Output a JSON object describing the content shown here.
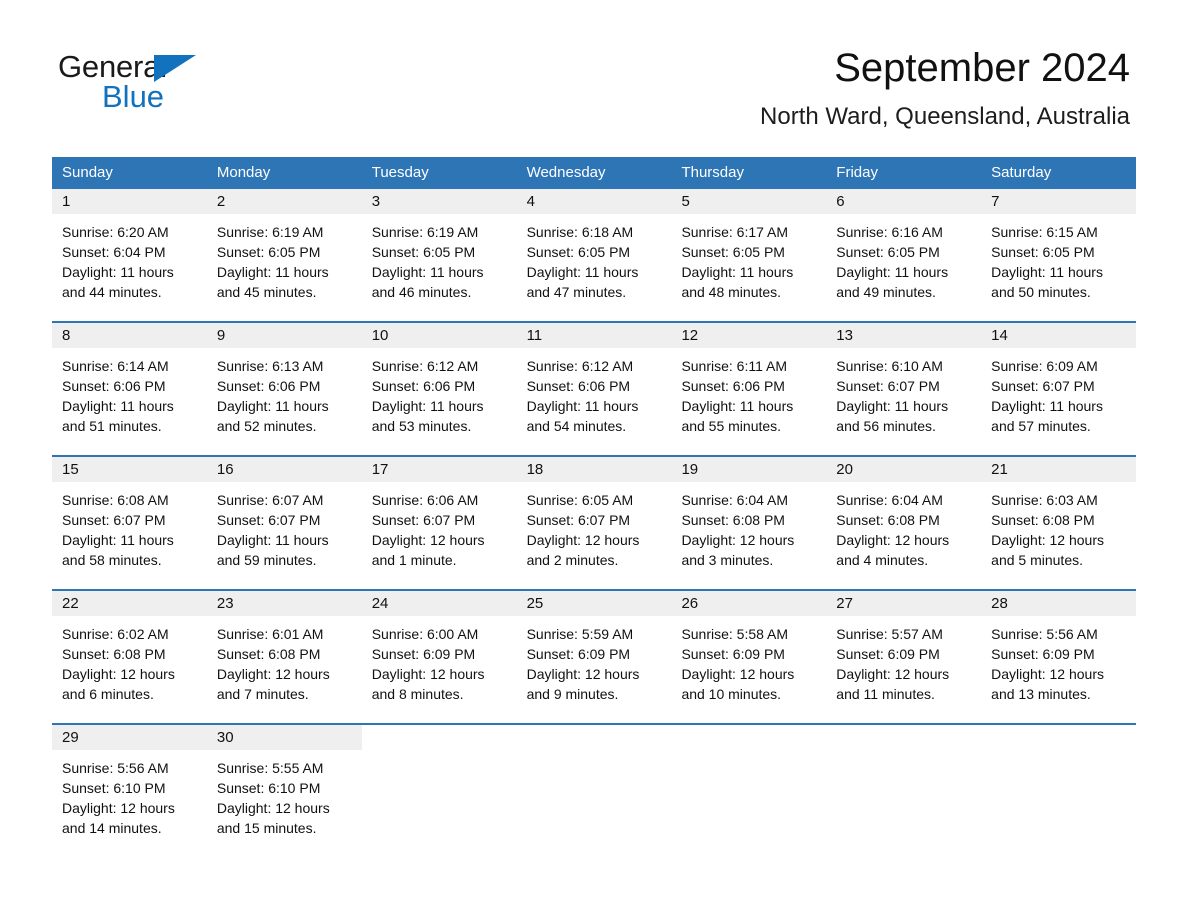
{
  "brand": {
    "line1": "General",
    "line2": "Blue",
    "accent_color": "#1272bd"
  },
  "header": {
    "month_title": "September 2024",
    "location": "North Ward, Queensland, Australia"
  },
  "calendar": {
    "header_color": "#2e75b6",
    "daynum_band_color": "#efefef",
    "weekday_headers": [
      "Sunday",
      "Monday",
      "Tuesday",
      "Wednesday",
      "Thursday",
      "Friday",
      "Saturday"
    ],
    "weeks": [
      [
        null,
        null,
        null,
        null,
        null,
        null,
        null
      ]
    ],
    "days": [
      {
        "day": "1",
        "sunrise": "Sunrise: 6:20 AM",
        "sunset": "Sunset: 6:04 PM",
        "daylight_line1": "Daylight: 11 hours",
        "daylight_line2": "and 44 minutes."
      },
      {
        "day": "2",
        "sunrise": "Sunrise: 6:19 AM",
        "sunset": "Sunset: 6:05 PM",
        "daylight_line1": "Daylight: 11 hours",
        "daylight_line2": "and 45 minutes."
      },
      {
        "day": "3",
        "sunrise": "Sunrise: 6:19 AM",
        "sunset": "Sunset: 6:05 PM",
        "daylight_line1": "Daylight: 11 hours",
        "daylight_line2": "and 46 minutes."
      },
      {
        "day": "4",
        "sunrise": "Sunrise: 6:18 AM",
        "sunset": "Sunset: 6:05 PM",
        "daylight_line1": "Daylight: 11 hours",
        "daylight_line2": "and 47 minutes."
      },
      {
        "day": "5",
        "sunrise": "Sunrise: 6:17 AM",
        "sunset": "Sunset: 6:05 PM",
        "daylight_line1": "Daylight: 11 hours",
        "daylight_line2": "and 48 minutes."
      },
      {
        "day": "6",
        "sunrise": "Sunrise: 6:16 AM",
        "sunset": "Sunset: 6:05 PM",
        "daylight_line1": "Daylight: 11 hours",
        "daylight_line2": "and 49 minutes."
      },
      {
        "day": "7",
        "sunrise": "Sunrise: 6:15 AM",
        "sunset": "Sunset: 6:05 PM",
        "daylight_line1": "Daylight: 11 hours",
        "daylight_line2": "and 50 minutes."
      },
      {
        "day": "8",
        "sunrise": "Sunrise: 6:14 AM",
        "sunset": "Sunset: 6:06 PM",
        "daylight_line1": "Daylight: 11 hours",
        "daylight_line2": "and 51 minutes."
      },
      {
        "day": "9",
        "sunrise": "Sunrise: 6:13 AM",
        "sunset": "Sunset: 6:06 PM",
        "daylight_line1": "Daylight: 11 hours",
        "daylight_line2": "and 52 minutes."
      },
      {
        "day": "10",
        "sunrise": "Sunrise: 6:12 AM",
        "sunset": "Sunset: 6:06 PM",
        "daylight_line1": "Daylight: 11 hours",
        "daylight_line2": "and 53 minutes."
      },
      {
        "day": "11",
        "sunrise": "Sunrise: 6:12 AM",
        "sunset": "Sunset: 6:06 PM",
        "daylight_line1": "Daylight: 11 hours",
        "daylight_line2": "and 54 minutes."
      },
      {
        "day": "12",
        "sunrise": "Sunrise: 6:11 AM",
        "sunset": "Sunset: 6:06 PM",
        "daylight_line1": "Daylight: 11 hours",
        "daylight_line2": "and 55 minutes."
      },
      {
        "day": "13",
        "sunrise": "Sunrise: 6:10 AM",
        "sunset": "Sunset: 6:07 PM",
        "daylight_line1": "Daylight: 11 hours",
        "daylight_line2": "and 56 minutes."
      },
      {
        "day": "14",
        "sunrise": "Sunrise: 6:09 AM",
        "sunset": "Sunset: 6:07 PM",
        "daylight_line1": "Daylight: 11 hours",
        "daylight_line2": "and 57 minutes."
      },
      {
        "day": "15",
        "sunrise": "Sunrise: 6:08 AM",
        "sunset": "Sunset: 6:07 PM",
        "daylight_line1": "Daylight: 11 hours",
        "daylight_line2": "and 58 minutes."
      },
      {
        "day": "16",
        "sunrise": "Sunrise: 6:07 AM",
        "sunset": "Sunset: 6:07 PM",
        "daylight_line1": "Daylight: 11 hours",
        "daylight_line2": "and 59 minutes."
      },
      {
        "day": "17",
        "sunrise": "Sunrise: 6:06 AM",
        "sunset": "Sunset: 6:07 PM",
        "daylight_line1": "Daylight: 12 hours",
        "daylight_line2": "and 1 minute."
      },
      {
        "day": "18",
        "sunrise": "Sunrise: 6:05 AM",
        "sunset": "Sunset: 6:07 PM",
        "daylight_line1": "Daylight: 12 hours",
        "daylight_line2": "and 2 minutes."
      },
      {
        "day": "19",
        "sunrise": "Sunrise: 6:04 AM",
        "sunset": "Sunset: 6:08 PM",
        "daylight_line1": "Daylight: 12 hours",
        "daylight_line2": "and 3 minutes."
      },
      {
        "day": "20",
        "sunrise": "Sunrise: 6:04 AM",
        "sunset": "Sunset: 6:08 PM",
        "daylight_line1": "Daylight: 12 hours",
        "daylight_line2": "and 4 minutes."
      },
      {
        "day": "21",
        "sunrise": "Sunrise: 6:03 AM",
        "sunset": "Sunset: 6:08 PM",
        "daylight_line1": "Daylight: 12 hours",
        "daylight_line2": "and 5 minutes."
      },
      {
        "day": "22",
        "sunrise": "Sunrise: 6:02 AM",
        "sunset": "Sunset: 6:08 PM",
        "daylight_line1": "Daylight: 12 hours",
        "daylight_line2": "and 6 minutes."
      },
      {
        "day": "23",
        "sunrise": "Sunrise: 6:01 AM",
        "sunset": "Sunset: 6:08 PM",
        "daylight_line1": "Daylight: 12 hours",
        "daylight_line2": "and 7 minutes."
      },
      {
        "day": "24",
        "sunrise": "Sunrise: 6:00 AM",
        "sunset": "Sunset: 6:09 PM",
        "daylight_line1": "Daylight: 12 hours",
        "daylight_line2": "and 8 minutes."
      },
      {
        "day": "25",
        "sunrise": "Sunrise: 5:59 AM",
        "sunset": "Sunset: 6:09 PM",
        "daylight_line1": "Daylight: 12 hours",
        "daylight_line2": "and 9 minutes."
      },
      {
        "day": "26",
        "sunrise": "Sunrise: 5:58 AM",
        "sunset": "Sunset: 6:09 PM",
        "daylight_line1": "Daylight: 12 hours",
        "daylight_line2": "and 10 minutes."
      },
      {
        "day": "27",
        "sunrise": "Sunrise: 5:57 AM",
        "sunset": "Sunset: 6:09 PM",
        "daylight_line1": "Daylight: 12 hours",
        "daylight_line2": "and 11 minutes."
      },
      {
        "day": "28",
        "sunrise": "Sunrise: 5:56 AM",
        "sunset": "Sunset: 6:09 PM",
        "daylight_line1": "Daylight: 12 hours",
        "daylight_line2": "and 13 minutes."
      },
      {
        "day": "29",
        "sunrise": "Sunrise: 5:56 AM",
        "sunset": "Sunset: 6:10 PM",
        "daylight_line1": "Daylight: 12 hours",
        "daylight_line2": "and 14 minutes."
      },
      {
        "day": "30",
        "sunrise": "Sunrise: 5:55 AM",
        "sunset": "Sunset: 6:10 PM",
        "daylight_line1": "Daylight: 12 hours",
        "daylight_line2": "and 15 minutes."
      }
    ]
  }
}
